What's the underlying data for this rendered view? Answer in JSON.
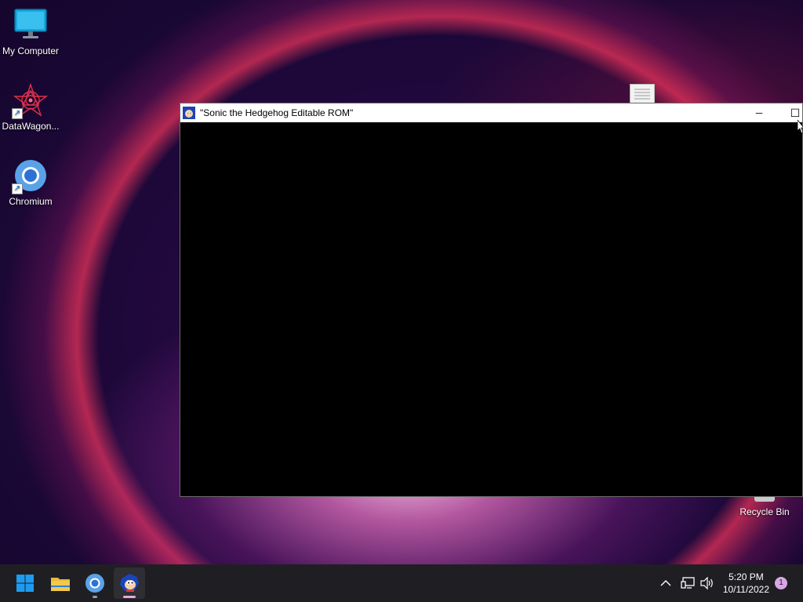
{
  "desktop": {
    "icons": [
      {
        "label": "My Computer"
      },
      {
        "label": "DataWagon..."
      },
      {
        "label": "Chromium"
      },
      {
        "label": "Recycle Bin"
      }
    ]
  },
  "window": {
    "title": "\"Sonic the Hedgehog Editable ROM\"",
    "minimize_glyph": "─",
    "maximize_glyph": "☐"
  },
  "taskbar": {
    "clock_time": "5:20 PM",
    "clock_date": "10/11/2022",
    "notification_count": "1",
    "tray_chevron": "^"
  },
  "colors": {
    "start_blue": "#1d9bf0",
    "folder_yellow": "#f2c94c",
    "taskbar_bg": "#1f1f23"
  }
}
